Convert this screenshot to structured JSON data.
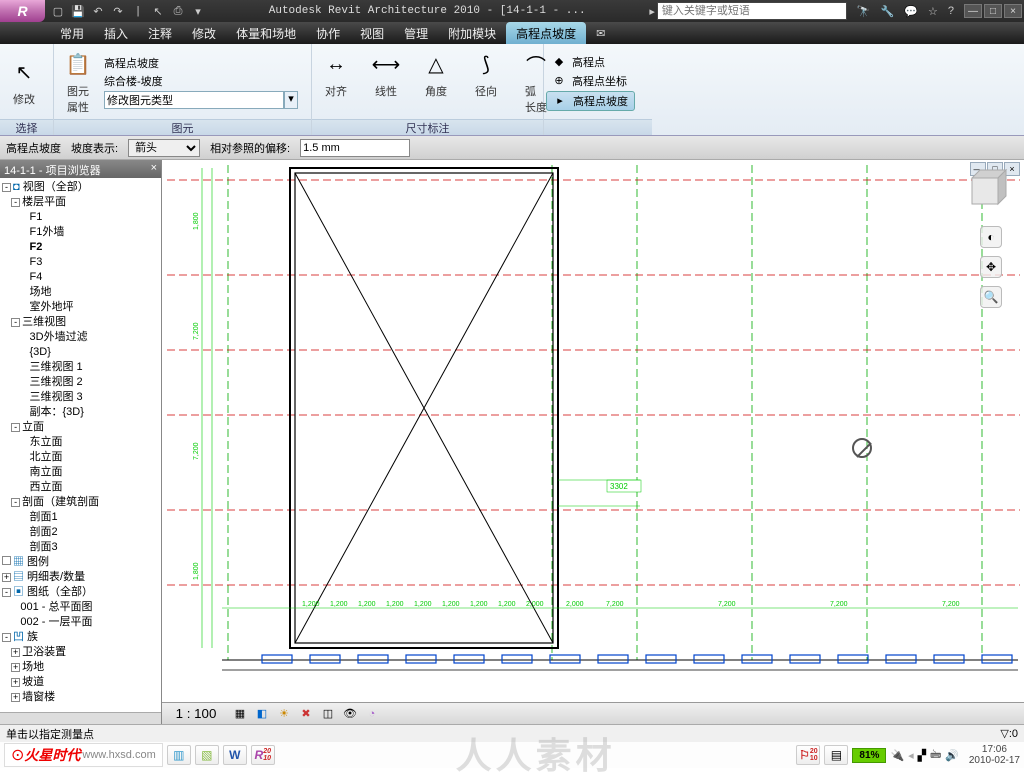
{
  "title": "Autodesk Revit Architecture 2010 - [14-1-1 - ...",
  "search_placeholder": "键入关键字或短语",
  "menu": [
    "常用",
    "插入",
    "注释",
    "修改",
    "体量和场地",
    "协作",
    "视图",
    "管理",
    "附加模块",
    "高程点坡度"
  ],
  "active_menu": 9,
  "ribbon": {
    "modify": "修改",
    "select": "选择",
    "elem_prop": "图元\n属性",
    "prop_line1": "高程点坡度",
    "prop_line2": "综合楼-坡度",
    "type_sel": "修改图元类型",
    "panel2": "图元",
    "dims": [
      {
        "lbl": "对齐",
        "ic": "↔"
      },
      {
        "lbl": "线性",
        "ic": "⟷"
      },
      {
        "lbl": "角度",
        "ic": "△"
      },
      {
        "lbl": "径向",
        "ic": "⟆"
      },
      {
        "lbl": "弧\n长度",
        "ic": "⌒"
      }
    ],
    "panel3": "尺寸标注",
    "spot": [
      {
        "lbl": "高程点",
        "ic": "◆"
      },
      {
        "lbl": "高程点坐标",
        "ic": "⊕"
      },
      {
        "lbl": "高程点坡度",
        "ic": "▸"
      }
    ]
  },
  "optbar": {
    "label1": "高程点坡度",
    "label2": "坡度表示:",
    "rep_val": "箭头",
    "label3": "相对参照的偏移:",
    "offset": "1.5 mm"
  },
  "browser": {
    "title": "14-1-1 - 项目浏览器",
    "items": [
      {
        "ind": 0,
        "exp": "-",
        "ic": "◘",
        "txt": "视图（全部）"
      },
      {
        "ind": 1,
        "exp": "-",
        "txt": "楼层平面"
      },
      {
        "ind": 2,
        "txt": "F1"
      },
      {
        "ind": 2,
        "txt": "F1外墙"
      },
      {
        "ind": 2,
        "txt": "F2",
        "active": true
      },
      {
        "ind": 2,
        "txt": "F3"
      },
      {
        "ind": 2,
        "txt": "F4"
      },
      {
        "ind": 2,
        "txt": "场地"
      },
      {
        "ind": 2,
        "txt": "室外地坪"
      },
      {
        "ind": 1,
        "exp": "-",
        "txt": "三维视图"
      },
      {
        "ind": 2,
        "txt": "3D外墙过滤"
      },
      {
        "ind": 2,
        "txt": "{3D}"
      },
      {
        "ind": 2,
        "txt": "三维视图 1"
      },
      {
        "ind": 2,
        "txt": "三维视图 2"
      },
      {
        "ind": 2,
        "txt": "三维视图 3"
      },
      {
        "ind": 2,
        "txt": "副本：{3D}"
      },
      {
        "ind": 1,
        "exp": "-",
        "txt": "立面"
      },
      {
        "ind": 2,
        "txt": "东立面"
      },
      {
        "ind": 2,
        "txt": "北立面"
      },
      {
        "ind": 2,
        "txt": "南立面"
      },
      {
        "ind": 2,
        "txt": "西立面"
      },
      {
        "ind": 1,
        "exp": "-",
        "txt": "剖面（建筑剖面"
      },
      {
        "ind": 2,
        "txt": "剖面1"
      },
      {
        "ind": 2,
        "txt": "剖面2"
      },
      {
        "ind": 2,
        "txt": "剖面3"
      },
      {
        "ind": 0,
        "exp": " ",
        "ic": "▦",
        "txt": "图例"
      },
      {
        "ind": 0,
        "exp": "+",
        "ic": "▤",
        "txt": "明细表/数量"
      },
      {
        "ind": 0,
        "exp": "-",
        "ic": "▣",
        "txt": "图纸（全部）"
      },
      {
        "ind": 1,
        "txt": "001 - 总平面图"
      },
      {
        "ind": 1,
        "txt": "002 - 一层平面"
      },
      {
        "ind": 0,
        "exp": "-",
        "ic": "凹",
        "txt": "族"
      },
      {
        "ind": 1,
        "exp": "+",
        "txt": "卫浴装置"
      },
      {
        "ind": 1,
        "exp": "+",
        "txt": "场地"
      },
      {
        "ind": 1,
        "exp": "+",
        "txt": "坡道"
      },
      {
        "ind": 1,
        "exp": "+",
        "txt": "墙窗楼"
      }
    ]
  },
  "scale": "1 : 100",
  "status": "单击以指定测量点",
  "filter": "0",
  "dim_label": "3302",
  "bottom_dims": [
    "1,200",
    "1,200",
    "1,200",
    "1,200",
    "1,200",
    "1,200",
    "1,200",
    "1,200",
    "2,000",
    "2,000",
    "7,200",
    "7,200",
    "7,200",
    "7,200"
  ],
  "battery": "81%",
  "clock_time": "17:06",
  "clock_date": "2010-02-17",
  "watermark": "人人素材"
}
